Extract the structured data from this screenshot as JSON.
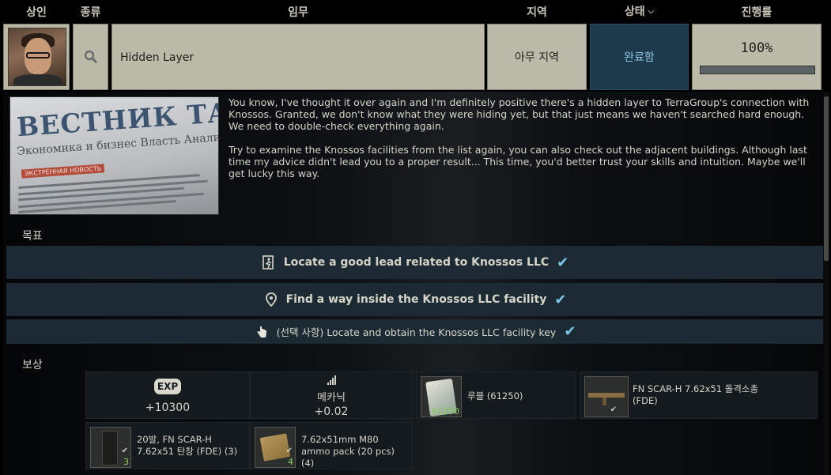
{
  "header": {
    "trader": "상인",
    "type": "종류",
    "quest": "임무",
    "location": "지역",
    "status": "상태",
    "progress": "진행률"
  },
  "quest": {
    "type_icon": "magnifier-icon",
    "name": "Hidden Layer",
    "location": "아무 지역",
    "status": "완료함",
    "progress_text": "100%",
    "progress_value": 1.0
  },
  "newspaper": {
    "title": "ВЕСТНИК ТАР",
    "subtitle": "Экономика и бизнес   Власть   Анали",
    "banner": "ЭКСТРЕННАЯ НОВОСТЬ"
  },
  "description": {
    "p1": "You know, I've thought it over again and I'm definitely positive there's a hidden layer to TerraGroup's connection with Knossos. Granted, we don't know what they were hiding yet, but that just means we haven't searched hard enough. We need to double-check everything again.",
    "p2": "Try to examine the Knossos facilities from the list again, you can also check out the adjacent buildings. Although last time my advice didn't lead you to a proper result... This time, you'd better trust your skills and intuition. Maybe we'll get lucky this way."
  },
  "objectives_label": "목표",
  "objectives": [
    {
      "icon": "exit-door-icon",
      "text": "Locate a good lead related to Knossos LLC"
    },
    {
      "icon": "location-pin-icon",
      "text": "Find a way inside the Knossos LLC facility"
    },
    {
      "icon": "hand-pointer-icon",
      "text": "(선택 사항) Locate and obtain the Knossos LLC facility key"
    }
  ],
  "rewards_label": "보상",
  "rewards": {
    "exp_icon_text": "EXP",
    "exp_value": "+10300",
    "skill_name": "메카닉",
    "skill_value": "+0.02",
    "roubles_label": "루블  (61250)",
    "roubles_count": "61250",
    "rifle_label": "FN SCAR-H 7.62x51 돌격소총 (FDE)",
    "mag_label": "20발, FN SCAR-H 7.62x51 탄창 (FDE) (3)",
    "mag_count": "3",
    "ammo_label": "7.62x51mm M80 ammo pack (20 pcs) (4)",
    "ammo_count": "4"
  },
  "colors": {
    "status_bg": "#1d3a4c",
    "status_text": "#8fc4e0",
    "objective_bg": "#1c2a33",
    "check": "#7dc7ea",
    "count_green": "#8ad15a"
  }
}
